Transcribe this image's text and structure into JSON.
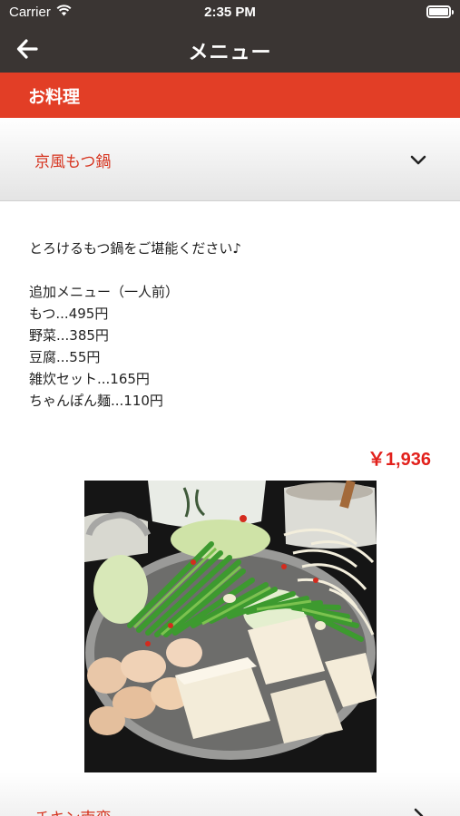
{
  "status_bar": {
    "carrier": "Carrier",
    "time": "2:35 PM"
  },
  "nav": {
    "title": "メニュー"
  },
  "section": {
    "title": "お料理"
  },
  "items": [
    {
      "name": "京風もつ鍋",
      "expanded": true,
      "description": [
        "とろけるもつ鍋をご堪能ください♪",
        "",
        "追加メニュー（一人前）",
        "もつ...495円",
        "野菜...385円",
        "豆腐...55円",
        "雑炊セット...165円",
        "ちゃんぽん麺...110円"
      ],
      "price": "￥1,936"
    },
    {
      "name": "チキン南蛮",
      "expanded": false
    }
  ],
  "colors": {
    "bar": "#3a3533",
    "accent": "#e23e26",
    "item_name": "#d6341f",
    "price": "#e2211c"
  }
}
